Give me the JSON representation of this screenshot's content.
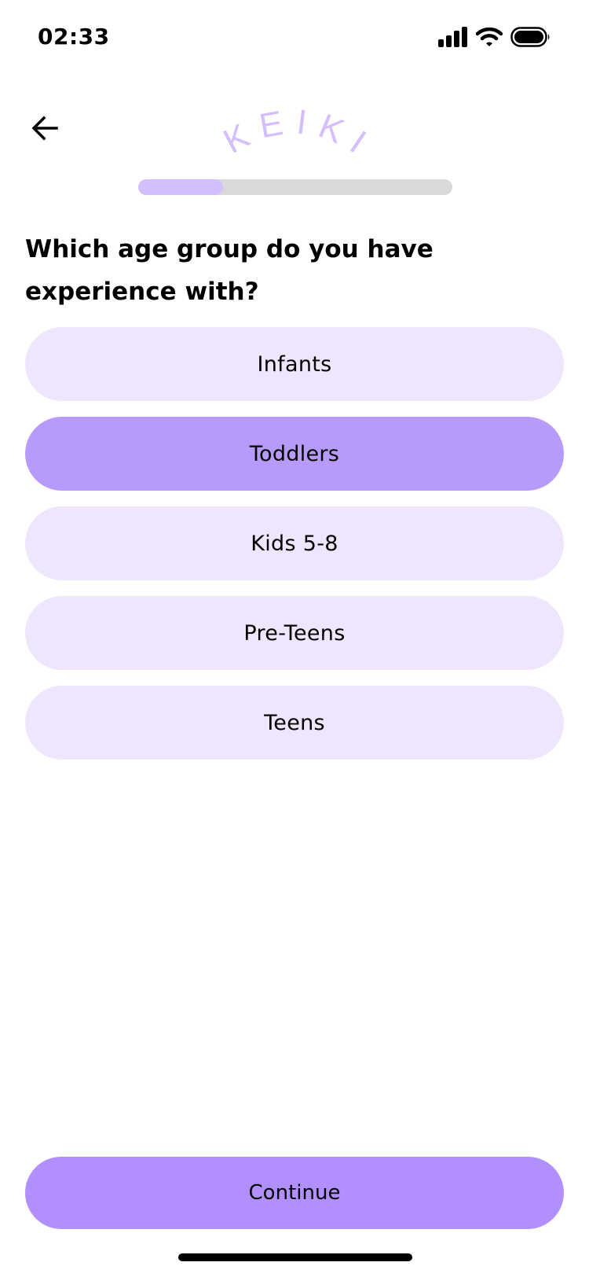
{
  "status_bar": {
    "time": "02:33",
    "icons": [
      "signal-icon",
      "wifi-icon",
      "battery-icon"
    ]
  },
  "header": {
    "back_icon": "arrow-left-icon",
    "logo_text": "KEIKI"
  },
  "progress": {
    "fraction": 0.27
  },
  "question": "Which age group do you have experience with?",
  "options": [
    {
      "label": "Infants",
      "selected": false
    },
    {
      "label": "Toddlers",
      "selected": true
    },
    {
      "label": "Kids 5-8",
      "selected": false
    },
    {
      "label": "Pre-Teens",
      "selected": false
    },
    {
      "label": "Teens",
      "selected": false
    }
  ],
  "continue_label": "Continue",
  "colors": {
    "option_bg": "#EFE6FD",
    "option_selected_bg": "#B89AFB",
    "continue_bg": "#B18FFE",
    "logo": "#D4BEFE",
    "progress_fill": "#D3BEFE",
    "progress_track": "#D9D9D9"
  }
}
